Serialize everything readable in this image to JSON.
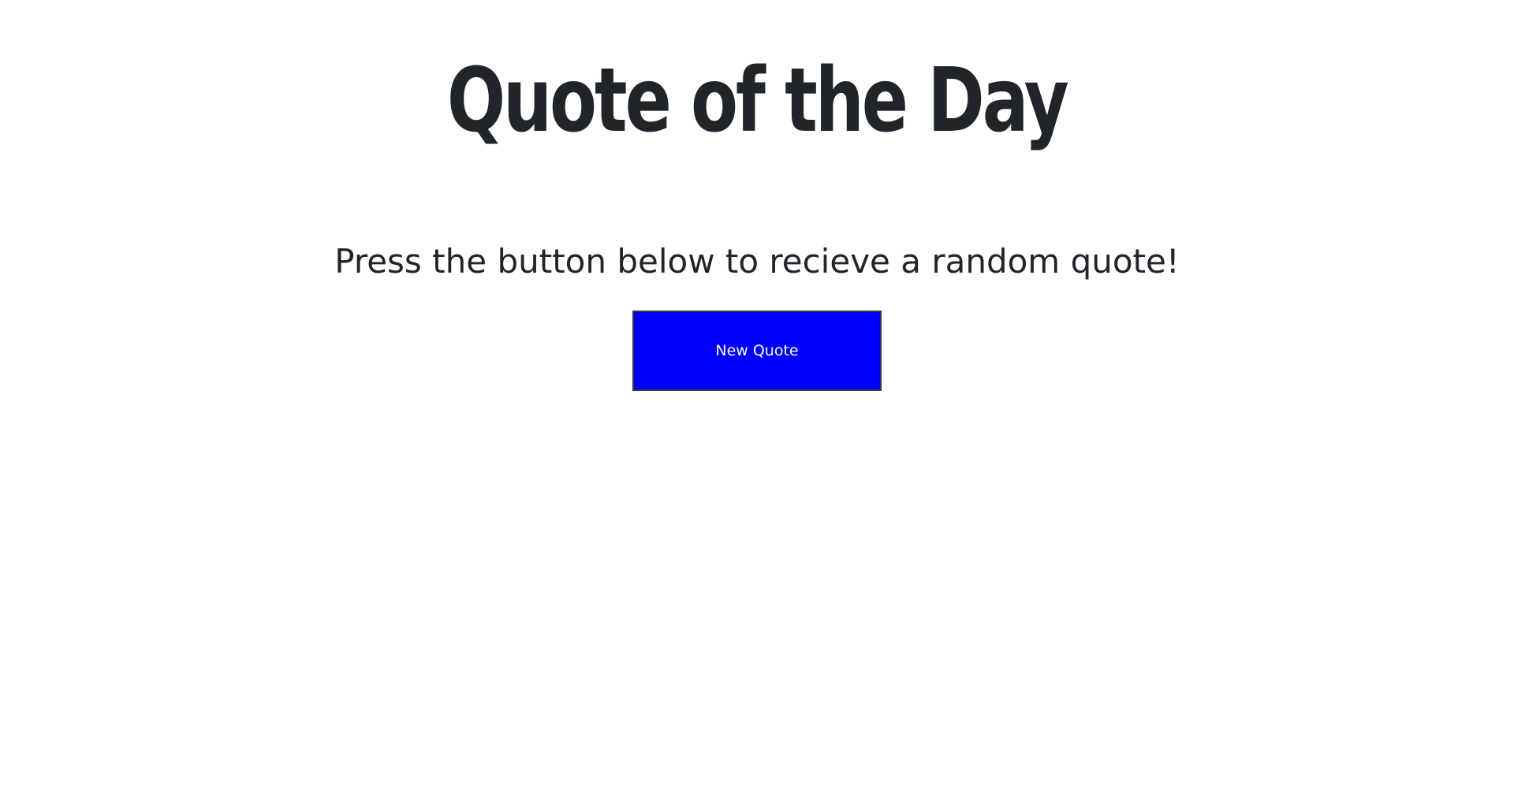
{
  "header": {
    "title": "Quote of the Day"
  },
  "main": {
    "instruction": "Press the button below to recieve a random quote!",
    "button_label": "New Quote"
  },
  "colors": {
    "button_background": "#0000ff",
    "button_text": "#ffffff",
    "text": "#212529",
    "page_background": "#ffffff"
  }
}
